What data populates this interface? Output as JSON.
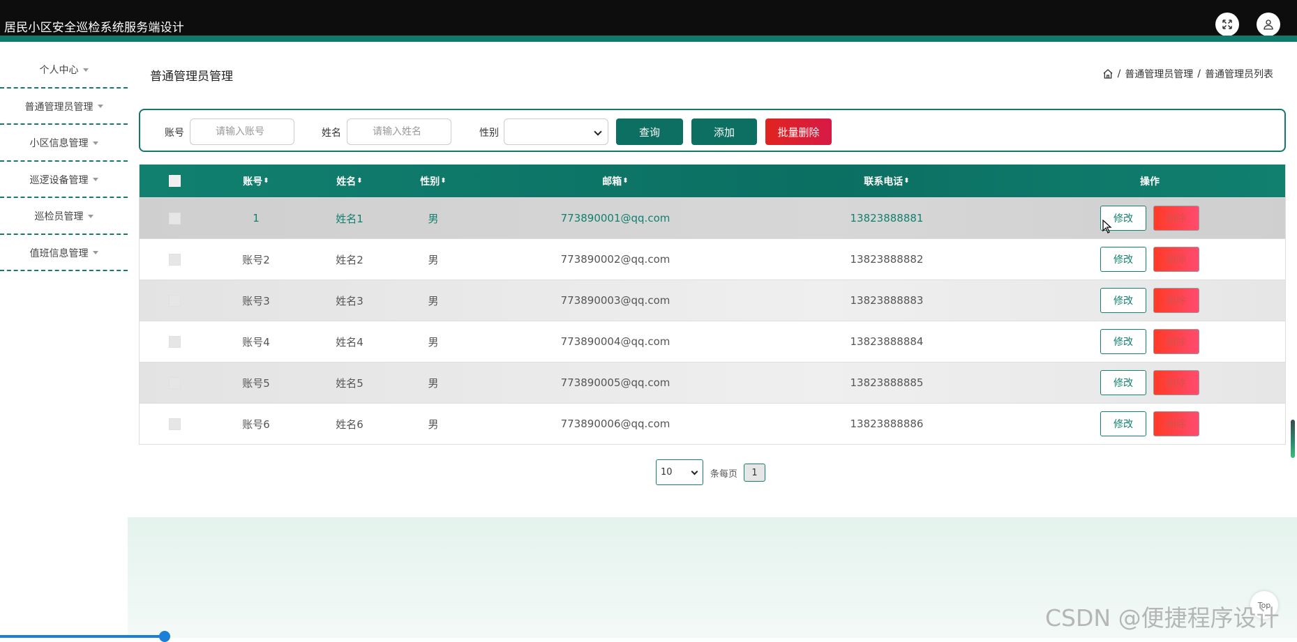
{
  "header": {
    "app_title": "居民小区安全巡检系统服务端设计",
    "icons": [
      "fullscreen-icon",
      "user-icon"
    ]
  },
  "sidebar": {
    "items": [
      {
        "label": "个人中心"
      },
      {
        "label": "普通管理员管理"
      },
      {
        "label": "小区信息管理"
      },
      {
        "label": "巡逻设备管理"
      },
      {
        "label": "巡检员管理"
      },
      {
        "label": "值班信息管理"
      }
    ]
  },
  "main": {
    "title": "普通管理员管理",
    "breadcrumb": [
      "普通管理员管理",
      "普通管理员列表"
    ],
    "breadcrumb_sep": "/"
  },
  "search": {
    "account_label": "账号",
    "account_placeholder": "请输入账号",
    "name_label": "姓名",
    "name_placeholder": "请输入姓名",
    "gender_label": "性别",
    "gender_value": "",
    "query_label": "查询",
    "add_label": "添加",
    "batch_delete_label": "批量删除"
  },
  "table": {
    "headers": {
      "account": "账号",
      "name": "姓名",
      "gender": "性别",
      "email": "邮箱",
      "phone": "联系电话",
      "actions": "操作"
    },
    "sort_glyph": "⬍",
    "edit_label": "修改",
    "delete_label": "删除",
    "rows": [
      {
        "account": "1",
        "name": "姓名1",
        "gender": "男",
        "email": "773890001@qq.com",
        "phone": "13823888881"
      },
      {
        "account": "账号2",
        "name": "姓名2",
        "gender": "男",
        "email": "773890002@qq.com",
        "phone": "13823888882"
      },
      {
        "account": "账号3",
        "name": "姓名3",
        "gender": "男",
        "email": "773890003@qq.com",
        "phone": "13823888883"
      },
      {
        "account": "账号4",
        "name": "姓名4",
        "gender": "男",
        "email": "773890004@qq.com",
        "phone": "13823888884"
      },
      {
        "account": "账号5",
        "name": "姓名5",
        "gender": "男",
        "email": "773890005@qq.com",
        "phone": "13823888885"
      },
      {
        "account": "账号6",
        "name": "姓名6",
        "gender": "男",
        "email": "773890006@qq.com",
        "phone": "13823888886"
      }
    ]
  },
  "pagination": {
    "page_size": "10",
    "per_page_label": "条每页",
    "current_page": "1"
  },
  "misc": {
    "top_button_label": "Top",
    "watermark": "CSDN @便捷程序设计"
  },
  "colors": {
    "accent": "#0f7a6b",
    "danger": "#e0241f",
    "topbar": "#0d0d0d"
  }
}
